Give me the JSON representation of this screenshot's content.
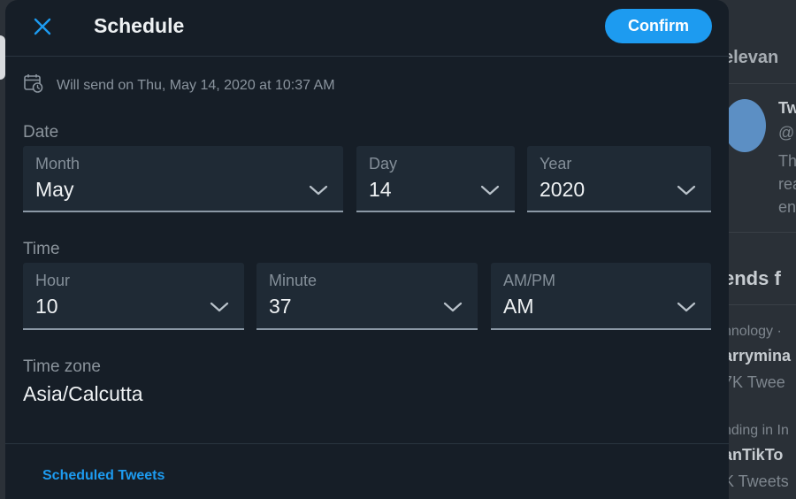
{
  "modal": {
    "title": "Schedule",
    "confirm_label": "Confirm",
    "send_note": "Will send on Thu, May 14, 2020 at 10:37 AM"
  },
  "date": {
    "section_label": "Date",
    "month": {
      "label": "Month",
      "value": "May"
    },
    "day": {
      "label": "Day",
      "value": "14"
    },
    "year": {
      "label": "Year",
      "value": "2020"
    }
  },
  "time": {
    "section_label": "Time",
    "hour": {
      "label": "Hour",
      "value": "10"
    },
    "minute": {
      "label": "Minute",
      "value": "37"
    },
    "ampm": {
      "label": "AM/PM",
      "value": "AM"
    }
  },
  "timezone": {
    "label": "Time zone",
    "value": "Asia/Calcutta"
  },
  "footer": {
    "scheduled_tweets_label": "Scheduled Tweets"
  },
  "background": {
    "heading_fragment": "elevan",
    "account_fragment": "Tw",
    "handle_fragment": "@",
    "bio_lines": [
      "Th",
      "rea",
      "en"
    ],
    "trends_fragment": "ends f",
    "trend_1_category": "nnology ·",
    "trend_1_name": "arrymina",
    "trend_1_count": "7K Twee",
    "trend_2_category": "nding in In",
    "trend_2_name": "anTikTo",
    "trend_2_count": "K Tweets"
  },
  "colors": {
    "accent": "#1d9bf0",
    "modal_bg": "#161e27",
    "field_bg": "#1f2a35"
  },
  "icons": {
    "close": "close-icon",
    "calendar": "calendar-clock-icon",
    "dropdown": "chevron-down-icon"
  }
}
